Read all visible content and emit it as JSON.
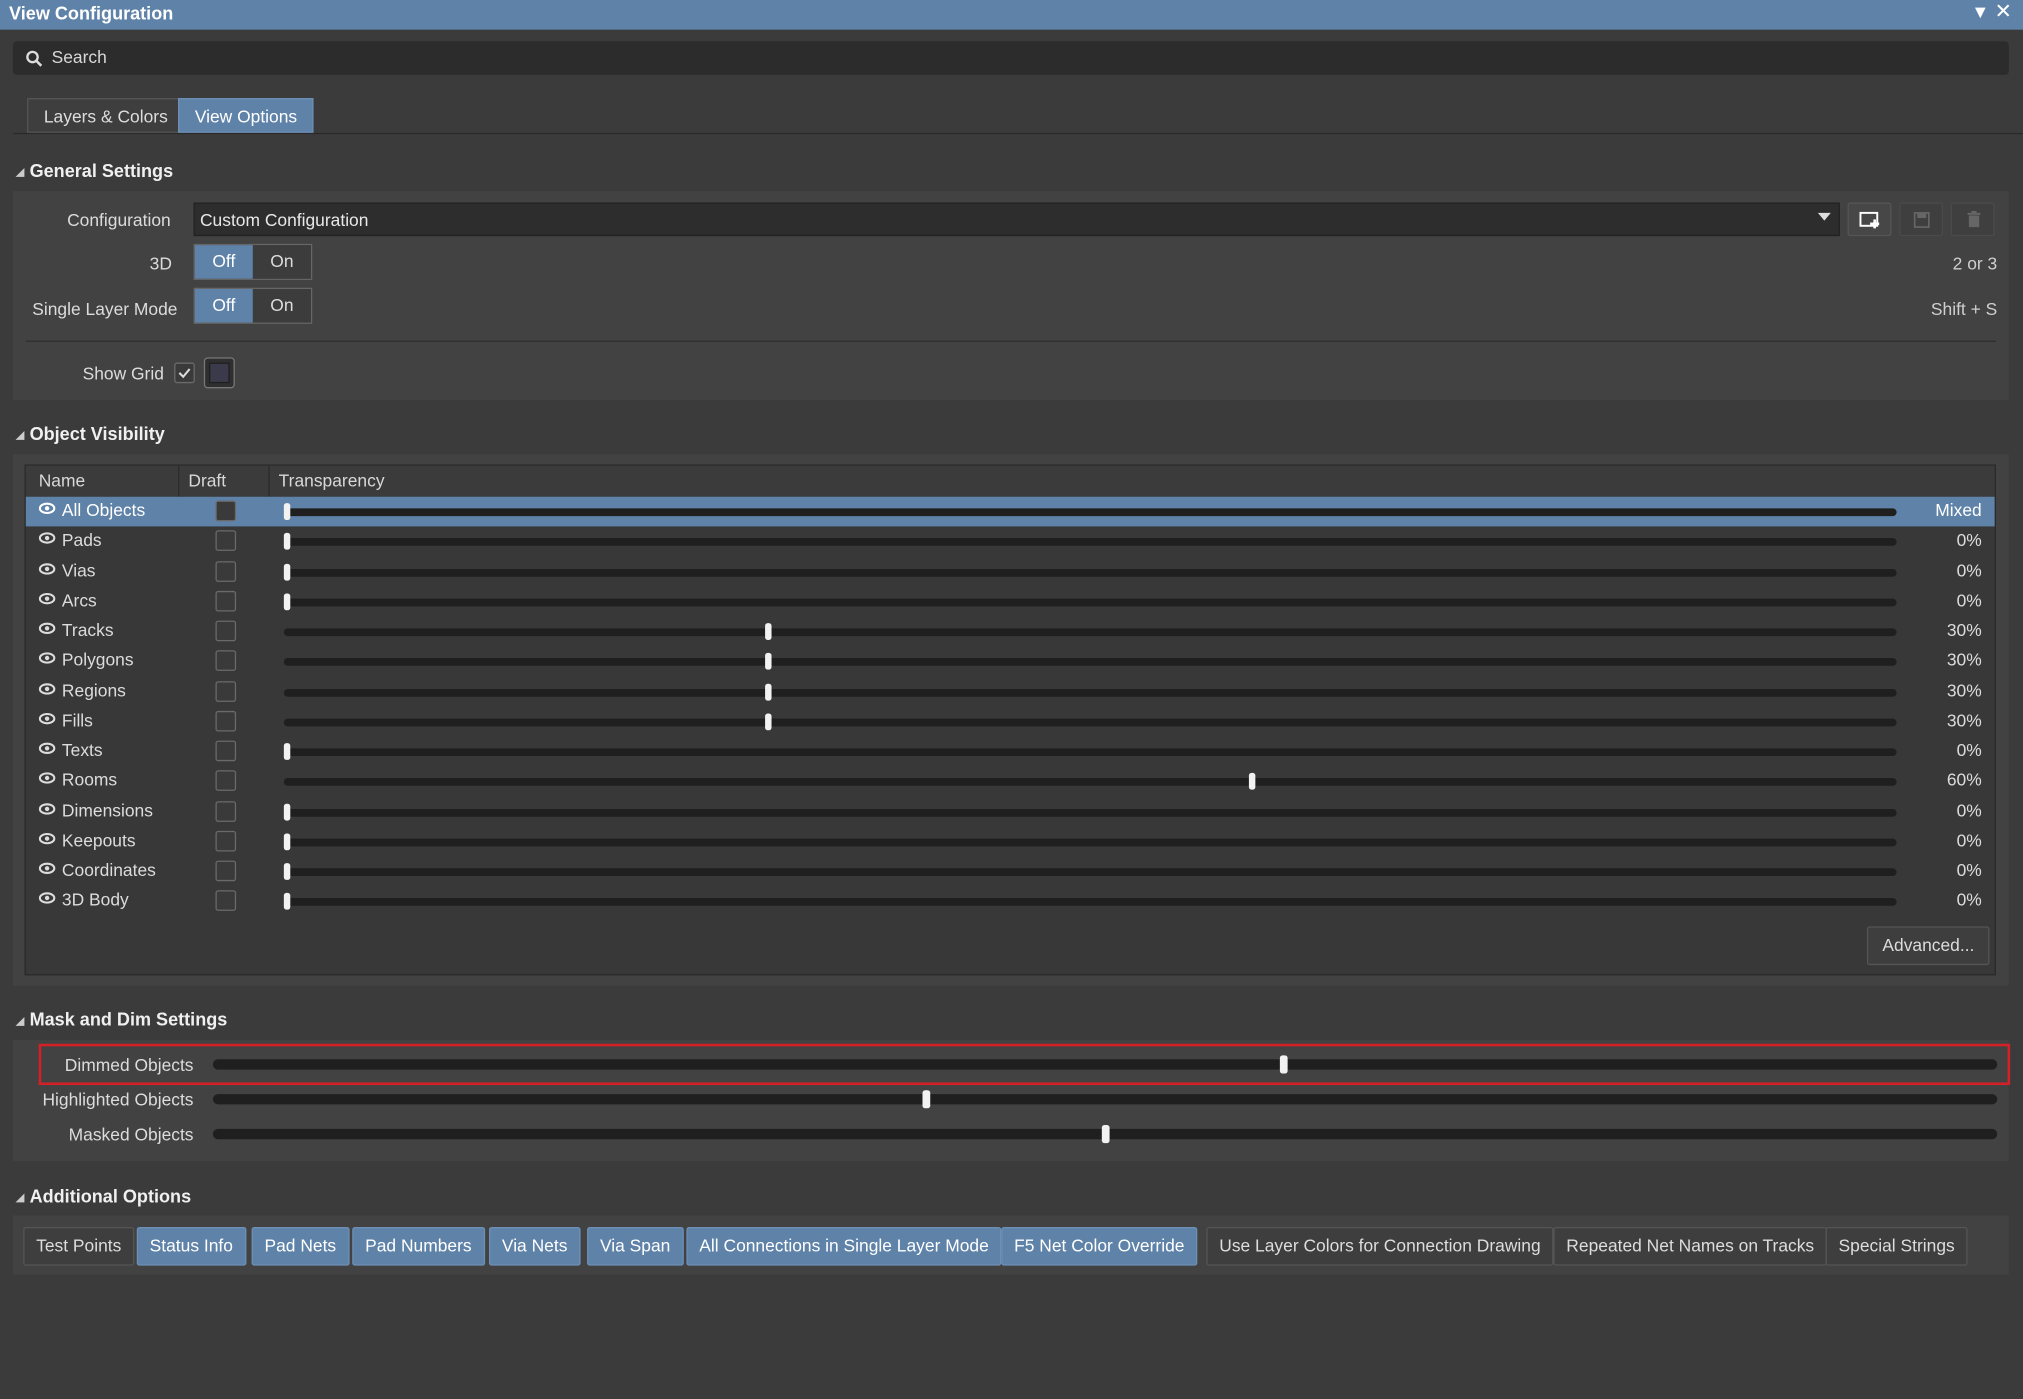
{
  "window": {
    "title": "View Configuration",
    "menu_icon": "triangle-down-icon",
    "close_icon": "close-icon"
  },
  "search": {
    "placeholder": "Search"
  },
  "tabs": [
    {
      "label": "Layers & Colors",
      "active": false
    },
    {
      "label": "View Options",
      "active": true
    }
  ],
  "general": {
    "title": "General Settings",
    "configuration_label": "Configuration",
    "configuration_value": "Custom Configuration",
    "three_d": {
      "label": "3D",
      "off": "Off",
      "on": "On",
      "selected": "Off",
      "shortcut": "2 or 3"
    },
    "single_layer": {
      "label": "Single Layer Mode",
      "off": "Off",
      "on": "On",
      "selected": "Off",
      "shortcut": "Shift + S"
    },
    "show_grid": {
      "label": "Show Grid",
      "checked": true
    }
  },
  "visibility": {
    "title": "Object Visibility",
    "columns": [
      "Name",
      "Draft",
      "Transparency"
    ],
    "rows": [
      {
        "name": "All Objects",
        "value": 0,
        "text": "Mixed",
        "selected": true
      },
      {
        "name": "Pads",
        "value": 0,
        "text": "0%"
      },
      {
        "name": "Vias",
        "value": 0,
        "text": "0%"
      },
      {
        "name": "Arcs",
        "value": 0,
        "text": "0%"
      },
      {
        "name": "Tracks",
        "value": 30,
        "text": "30%"
      },
      {
        "name": "Polygons",
        "value": 30,
        "text": "30%"
      },
      {
        "name": "Regions",
        "value": 30,
        "text": "30%"
      },
      {
        "name": "Fills",
        "value": 30,
        "text": "30%"
      },
      {
        "name": "Texts",
        "value": 0,
        "text": "0%"
      },
      {
        "name": "Rooms",
        "value": 60,
        "text": "60%"
      },
      {
        "name": "Dimensions",
        "value": 0,
        "text": "0%"
      },
      {
        "name": "Keepouts",
        "value": 0,
        "text": "0%"
      },
      {
        "name": "Coordinates",
        "value": 0,
        "text": "0%"
      },
      {
        "name": "3D Body",
        "value": 0,
        "text": "0%"
      }
    ],
    "advanced_label": "Advanced..."
  },
  "mask": {
    "title": "Mask and Dim Settings",
    "sliders": [
      {
        "label": "Dimmed Objects",
        "value": 0.6
      },
      {
        "label": "Highlighted Objects",
        "value": 0.4
      },
      {
        "label": "Masked Objects",
        "value": 0.5
      }
    ]
  },
  "additional": {
    "title": "Additional Options",
    "chips": [
      {
        "label": "Test Points",
        "on": false
      },
      {
        "label": "Status Info",
        "on": true
      },
      {
        "label": "Pad Nets",
        "on": true
      },
      {
        "label": "Pad Numbers",
        "on": true
      },
      {
        "label": "Via Nets",
        "on": true
      },
      {
        "label": "Via Span",
        "on": true
      },
      {
        "label": "All Connections in Single Layer Mode",
        "on": true
      },
      {
        "label": "F5   Net Color Override",
        "on": true
      },
      {
        "label": "Use Layer Colors for Connection Drawing",
        "on": false
      },
      {
        "label": "Repeated Net Names on Tracks",
        "on": false
      },
      {
        "label": "Special Strings",
        "on": false
      }
    ]
  },
  "colors": {
    "accent": "#5f82a8",
    "highlight": "#d42027",
    "background": "#3b3b3b"
  }
}
